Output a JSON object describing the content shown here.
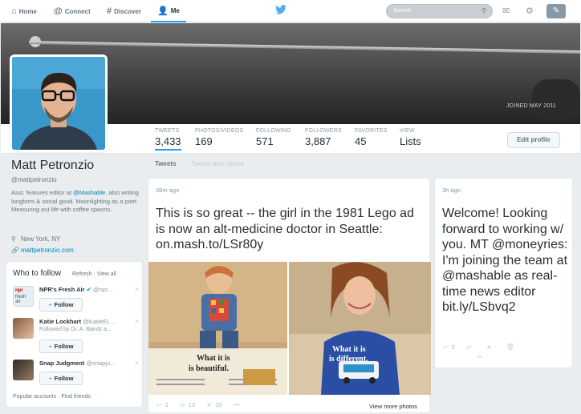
{
  "nav": {
    "home": "Home",
    "connect": "Connect",
    "discover": "Discover",
    "me": "Me",
    "search_placeholder": "Search"
  },
  "banner": {
    "joined": "JOINED MAY 2011"
  },
  "stats": [
    {
      "label": "TWEETS",
      "value": "3,433"
    },
    {
      "label": "PHOTOS/VIDEOS",
      "value": "169"
    },
    {
      "label": "FOLLOWING",
      "value": "571"
    },
    {
      "label": "FOLLOWERS",
      "value": "3,887"
    },
    {
      "label": "FAVORITES",
      "value": "45"
    },
    {
      "label": "VIEW",
      "value": "Lists"
    }
  ],
  "edit_profile": "Edit profile",
  "profile": {
    "name": "Matt Petronzio",
    "handle": "@mattpetronzio",
    "bio_1": "Asst. features editor at ",
    "bio_mention": "@Mashable",
    "bio_2": ", also writing longform & social good. Moonlighting as a poet. Measuring out life with coffee spoons.",
    "location": "New York, NY",
    "website": "mattpetronzio.com"
  },
  "tabs": {
    "tweets": "Tweets",
    "replies": "Tweets and replies"
  },
  "who_to_follow": {
    "title": "Who to follow",
    "refresh": "Refresh",
    "view_all": "View all",
    "follow_label": "Follow",
    "suggestions": [
      {
        "name": "NPR's Fresh Air",
        "handle": "@npr...",
        "sub": ""
      },
      {
        "name": "Katie Lockhart",
        "handle": "@KatieEL...",
        "sub": "Followed by Dr. A. Bandz a..."
      },
      {
        "name": "Snap Judgment",
        "handle": "@snapju...",
        "sub": ""
      }
    ],
    "popular": "Popular accounts",
    "find_friends": "Find friends"
  },
  "tweet1": {
    "time": "38m ago",
    "text": "This is so great -- the girl in the 1981 Lego ad is now an alt-medicine doctor in Seattle: ",
    "link": "on.mash.to/LSr80y",
    "photo_left_caption": "What it is is beautiful.",
    "photo_right_caption": "What it is is different.",
    "retweets": "13",
    "favorites": "10",
    "reply_count": "1",
    "view_more": "View more photos"
  },
  "tweet2": {
    "time": "3h ago",
    "text": "Welcome! Looking forward to working w/ you. MT @moneyries: I'm joining the team at @mashable as real-time news editor ",
    "link": "bit.ly/LSbvq2",
    "reply_count": "2"
  },
  "colors": {
    "accent": "#1da1f2",
    "link": "#0084b4",
    "nav_bg": "#ffffff",
    "page_bg": "#e9edf0"
  }
}
